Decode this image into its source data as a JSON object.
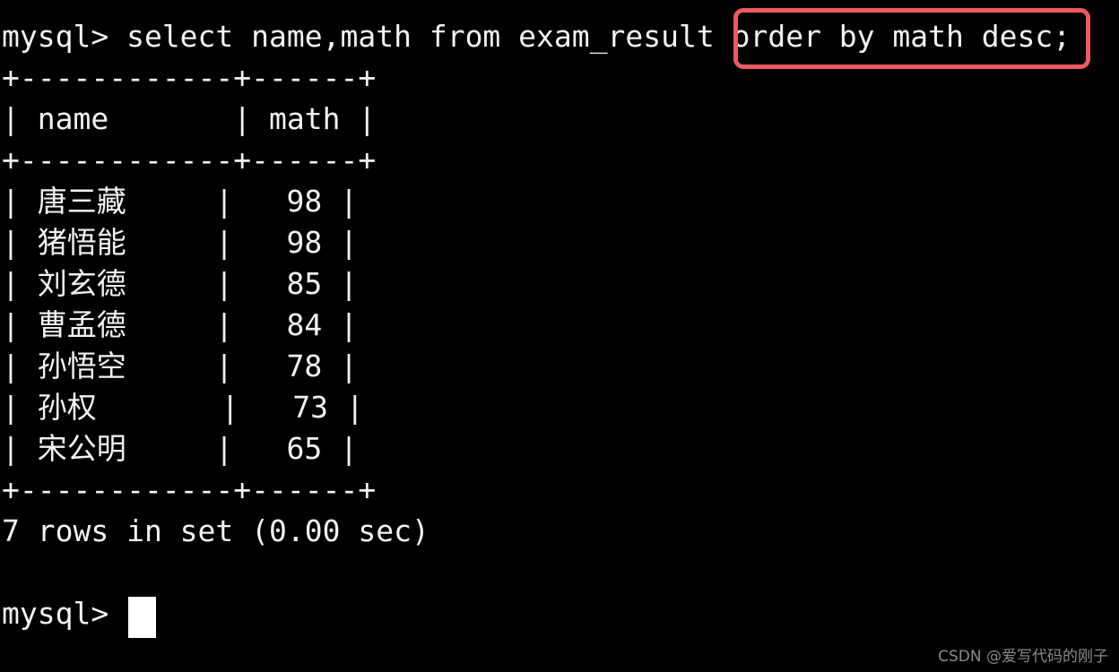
{
  "terminal": {
    "background_color": "#000000",
    "text_color": "#f2f2f2",
    "prompt": "mysql> ",
    "command": "select name,math from exam_result ",
    "highlighted_clause": "order by math desc;",
    "highlight_color": "#ee5a60",
    "cursor": "block-cursor",
    "lines": {
      "separator_top": "+------------+------+",
      "header_row": "| name       | math |",
      "separator_mid": "+------------+------+",
      "separator_bottom": "+------------+------+",
      "result_status": "7 rows in set (0.00 sec)",
      "blank": "",
      "final_prompt": "mysql> "
    },
    "rows": [
      {
        "line": "| 唐三藏     |   98 |",
        "name": "唐三藏",
        "math": 98
      },
      {
        "line": "| 猪悟能     |   98 |",
        "name": "猪悟能",
        "math": 98
      },
      {
        "line": "| 刘玄德     |   85 |",
        "name": "刘玄德",
        "math": 85
      },
      {
        "line": "| 曹孟德     |   84 |",
        "name": "曹孟德",
        "math": 84
      },
      {
        "line": "| 孙悟空     |   78 |",
        "name": "孙悟空",
        "math": 78
      },
      {
        "line": "| 孙权       |   73 |",
        "name": "孙权",
        "math": 73
      },
      {
        "line": "| 宋公明     |   65 |",
        "name": "宋公明",
        "math": 65
      }
    ],
    "columns": [
      "name",
      "math"
    ],
    "row_count_text": "7 rows in set (0.00 sec)"
  },
  "watermark": {
    "text": "CSDN @爱写代码的刚子"
  }
}
